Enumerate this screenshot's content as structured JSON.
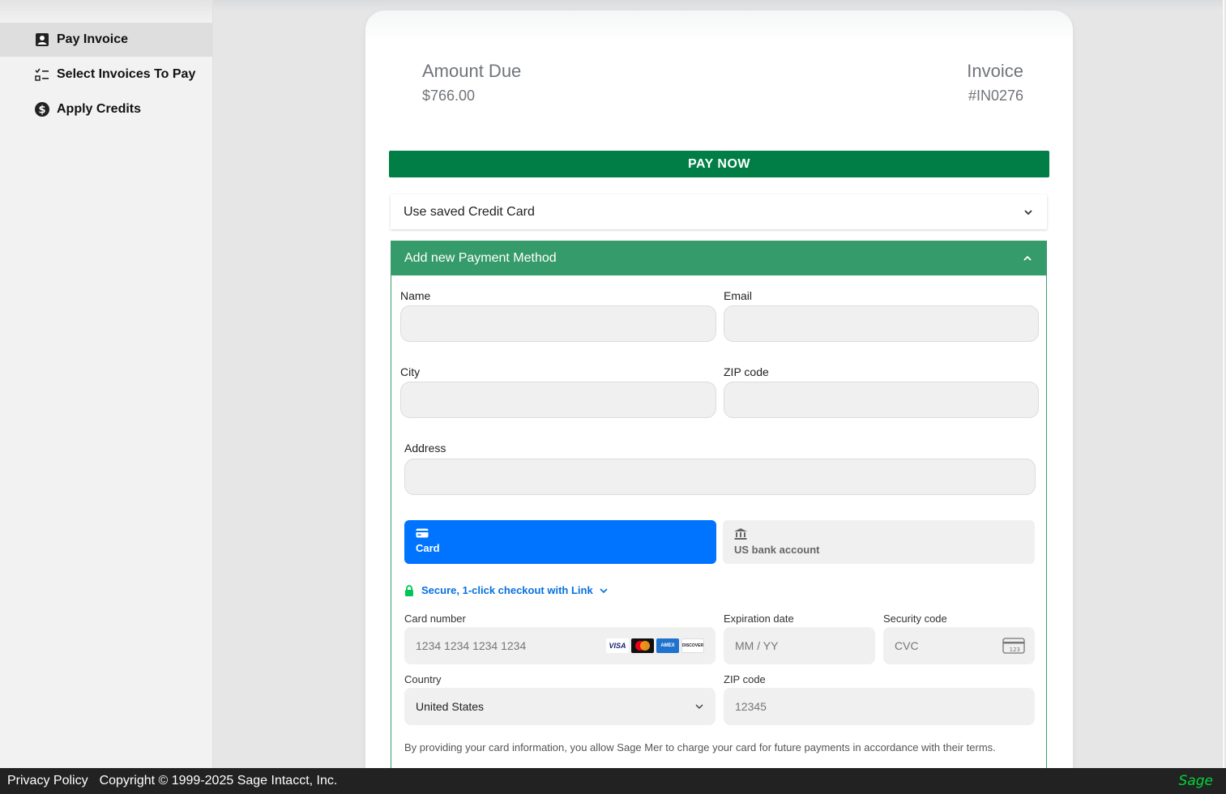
{
  "sidebar": {
    "items": [
      {
        "label": "Pay Invoice",
        "icon": "contact-card-icon",
        "active": true
      },
      {
        "label": "Select Invoices To Pay",
        "icon": "checklist-icon",
        "active": false
      },
      {
        "label": "Apply Credits",
        "icon": "dollar-circle-icon",
        "active": false
      }
    ]
  },
  "summary": {
    "amount_label": "Amount Due",
    "amount_value": "$766.00",
    "invoice_label": "Invoice",
    "invoice_value": "#IN0276"
  },
  "pay_now_label": "PAY NOW",
  "saved_card": {
    "label": "Use saved Credit Card"
  },
  "new_method": {
    "label": "Add new Payment Method",
    "fields": {
      "name": "Name",
      "email": "Email",
      "city": "City",
      "zip": "ZIP code",
      "address": "Address"
    },
    "tabs": [
      {
        "label": "Card",
        "icon": "credit-card-icon",
        "selected": true
      },
      {
        "label": "US bank account",
        "icon": "bank-icon",
        "selected": false
      }
    ],
    "link_text": "Secure, 1-click checkout with Link",
    "card": {
      "number_label": "Card number",
      "number_placeholder": "1234 1234 1234 1234",
      "expiry_label": "Expiration date",
      "expiry_placeholder": "MM / YY",
      "cvc_label": "Security code",
      "cvc_placeholder": "CVC",
      "country_label": "Country",
      "country_value": "United States",
      "zip_label": "ZIP code",
      "zip_placeholder": "12345",
      "brands": [
        "VISA",
        "MC",
        "AMEX",
        "DISCOVER"
      ]
    },
    "disclaimer": "By providing your card information, you allow Sage Mer to charge your card for future payments in accordance with their terms."
  },
  "footer": {
    "privacy": "Privacy Policy",
    "copyright": "Copyright © 1999-2025 Sage Intacct, Inc.",
    "logo": "Sage"
  },
  "colors": {
    "primary_green": "#007e45",
    "accordion_green": "#369b6a",
    "stripe_blue": "#0074ff",
    "link_blue": "#0570de"
  }
}
